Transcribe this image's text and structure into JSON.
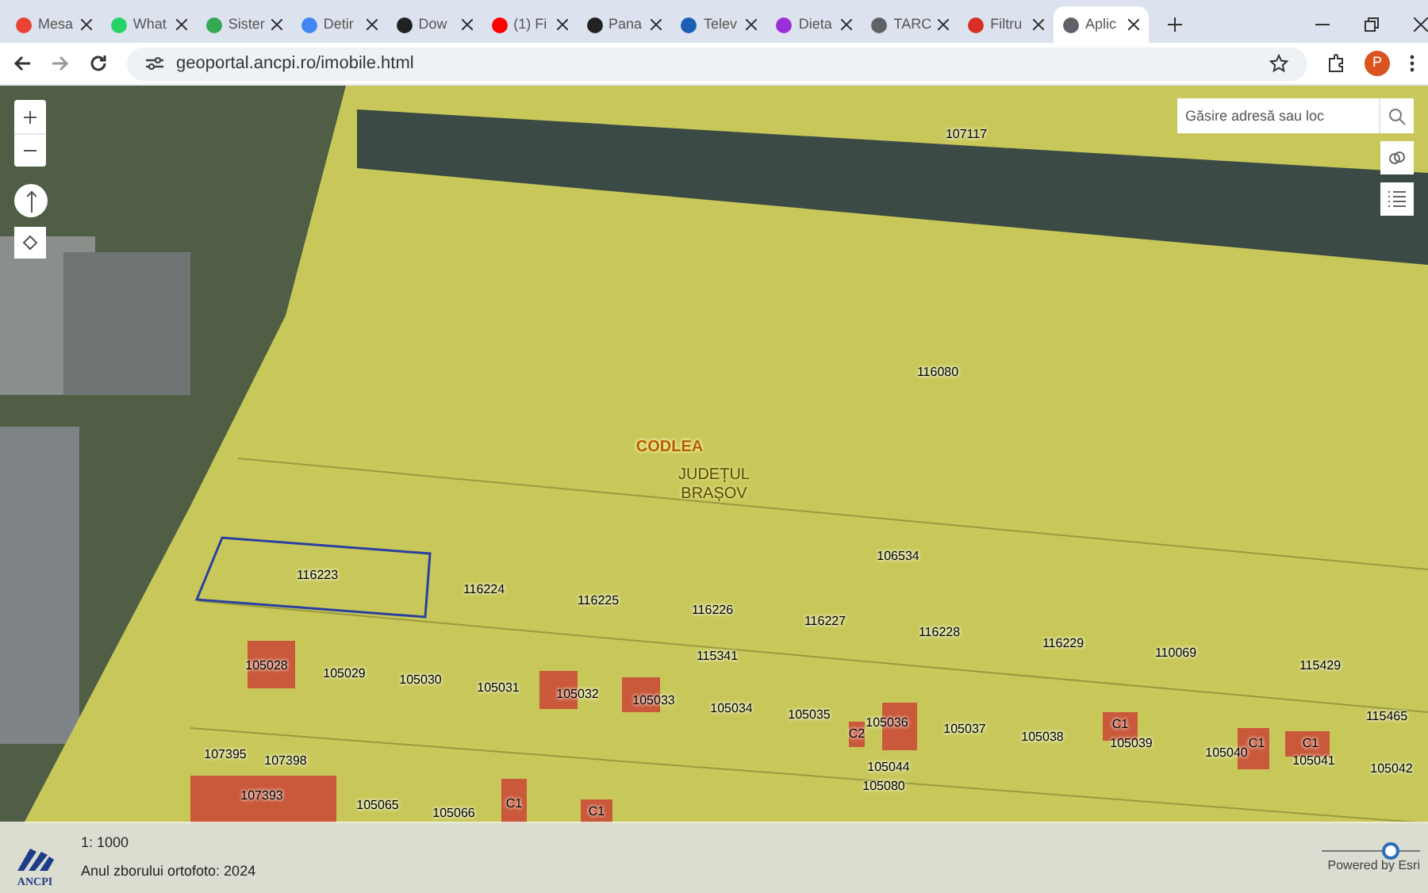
{
  "browser": {
    "tabs": [
      {
        "label": "Mesa",
        "selected": false
      },
      {
        "label": "What",
        "selected": false
      },
      {
        "label": "Sister",
        "selected": false
      },
      {
        "label": "Detir",
        "selected": false
      },
      {
        "label": "Dow",
        "selected": false
      },
      {
        "label": "(1) Fi",
        "selected": false
      },
      {
        "label": "Pana",
        "selected": false
      },
      {
        "label": "Telev",
        "selected": false
      },
      {
        "label": "Dieta",
        "selected": false
      },
      {
        "label": "TARC",
        "selected": false
      },
      {
        "label": "Filtru",
        "selected": false
      },
      {
        "label": "Aplic",
        "selected": true
      }
    ],
    "url": "geoportal.ancpi.ro/imobile.html",
    "profile_initial": "P"
  },
  "map": {
    "search": {
      "placeholder": "Găsire adresă sau loc"
    },
    "place_labels": [
      {
        "text": "CODLEA",
        "kind": "town"
      },
      {
        "text": "JUDEȚUL BRAȘOV",
        "kind": "county"
      }
    ],
    "parcels": [
      {
        "number": "107117",
        "selected": false
      },
      {
        "number": "116080",
        "selected": false
      },
      {
        "number": "106534",
        "selected": false
      },
      {
        "number": "116223",
        "selected": true
      },
      {
        "number": "116224",
        "selected": false
      },
      {
        "number": "116225",
        "selected": false
      },
      {
        "number": "116226",
        "selected": false
      },
      {
        "number": "116227",
        "selected": false
      },
      {
        "number": "116228",
        "selected": false
      },
      {
        "number": "116229",
        "selected": false
      },
      {
        "number": "110069",
        "selected": false
      },
      {
        "number": "115429",
        "selected": false
      },
      {
        "number": "115341",
        "selected": false
      },
      {
        "number": "105028",
        "selected": false
      },
      {
        "number": "105029",
        "selected": false
      },
      {
        "number": "105030",
        "selected": false
      },
      {
        "number": "105031",
        "selected": false
      },
      {
        "number": "105032",
        "selected": false
      },
      {
        "number": "105033",
        "selected": false
      },
      {
        "number": "105034",
        "selected": false
      },
      {
        "number": "105035",
        "selected": false
      },
      {
        "number": "105036",
        "selected": false
      },
      {
        "number": "105037",
        "selected": false
      },
      {
        "number": "105038",
        "selected": false
      },
      {
        "number": "105039",
        "selected": false
      },
      {
        "number": "105040",
        "selected": false
      },
      {
        "number": "105041",
        "selected": false
      },
      {
        "number": "105042",
        "selected": false
      },
      {
        "number": "115465",
        "selected": false
      },
      {
        "number": "105044",
        "selected": false
      },
      {
        "number": "105080",
        "selected": false
      },
      {
        "number": "107395",
        "selected": false
      },
      {
        "number": "107398",
        "selected": false
      },
      {
        "number": "107393",
        "selected": false
      },
      {
        "number": "105065",
        "selected": false
      },
      {
        "number": "105066",
        "selected": false
      }
    ],
    "buildings": [
      "C1",
      "C1",
      "C1",
      "C2",
      "C1",
      "C1"
    ]
  },
  "footer": {
    "scale": "1: 1000",
    "orthophoto_year": "Anul zborului ortofoto: 2024",
    "logo": "ANCPI",
    "credit": "Powered by Esri",
    "slider": {
      "level": 0.7
    }
  }
}
